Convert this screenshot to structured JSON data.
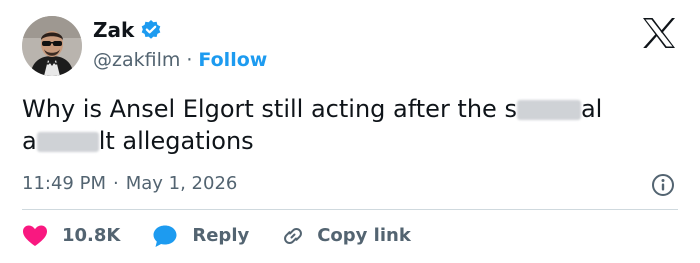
{
  "tweet": {
    "author": {
      "display_name": "Zak",
      "handle": "@zakfilm",
      "verified": true,
      "avatar_icon": "profile-photo"
    },
    "follow_separator": "·",
    "follow_label": "Follow",
    "brand_icon": "x-logo-icon",
    "text": {
      "part1": "Why is Ansel Elgort still acting after the s",
      "part2": "al",
      "part3": "a",
      "part4": "lt allegations"
    },
    "time": "11:49 PM",
    "time_separator": "·",
    "date": "May 1, 2026",
    "info_icon": "info-icon",
    "actions": {
      "like_count": "10.8K",
      "reply_label": "Reply",
      "copy_link_label": "Copy link"
    },
    "colors": {
      "accent": "#1d9bf0",
      "like": "#f91880",
      "secondary_text": "#536471",
      "divider": "#cfd9de"
    }
  }
}
